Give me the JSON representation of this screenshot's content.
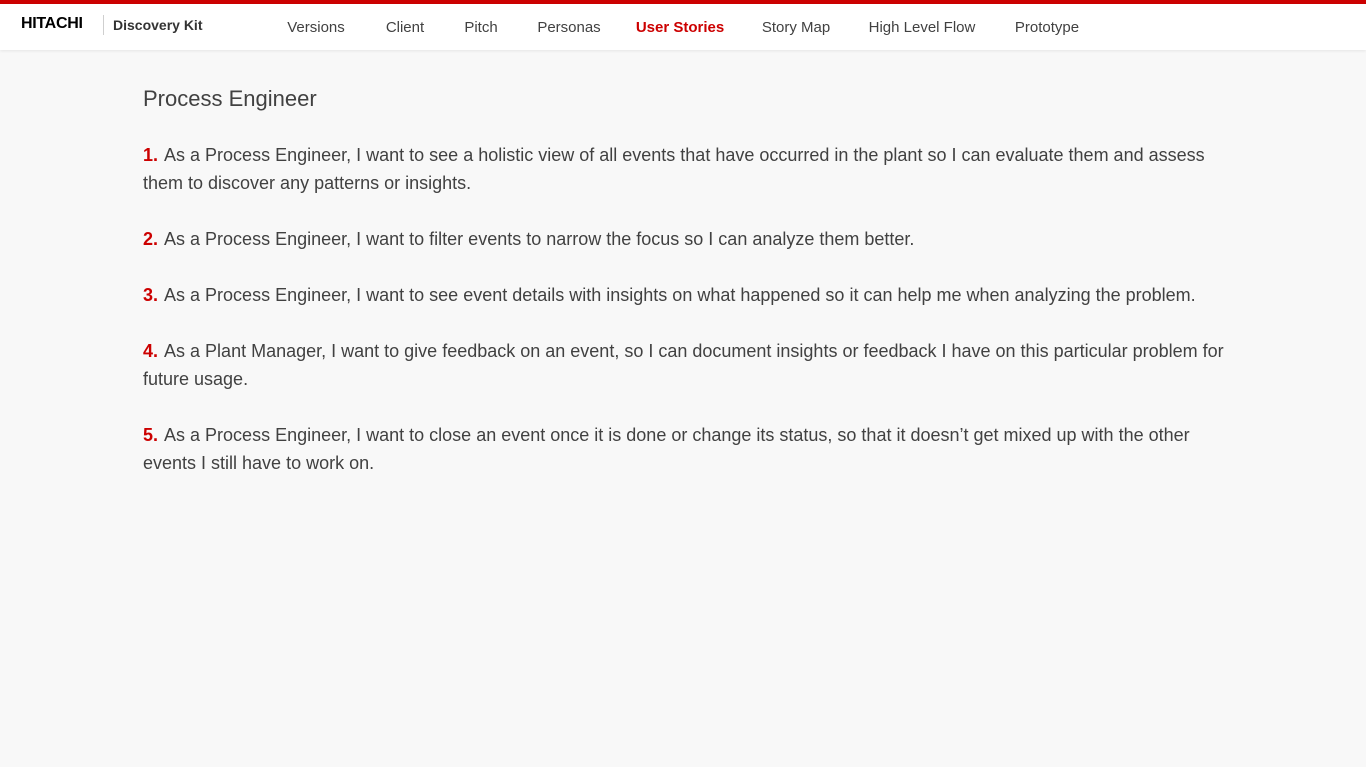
{
  "header": {
    "logo": "HITACHI",
    "app_name": "Discovery Kit",
    "nav": [
      {
        "label": "Versions"
      },
      {
        "label": "Client"
      },
      {
        "label": "Pitch"
      },
      {
        "label": "Personas"
      },
      {
        "label": "User Stories",
        "active": true
      },
      {
        "label": "Story Map"
      },
      {
        "label": "High Level Flow"
      },
      {
        "label": "Prototype"
      }
    ],
    "accent_color": "#cc0000"
  },
  "main": {
    "title": "Process Engineer",
    "stories": [
      {
        "num": "1.",
        "text": "As a Process Engineer, I want to see a holistic view of all events that have occurred in the plant so I can evaluate them and assess them to discover any patterns or insights."
      },
      {
        "num": "2.",
        "text": "As a Process Engineer, I want to filter events to narrow the focus so I can analyze them better."
      },
      {
        "num": "3.",
        "text": "As a Process Engineer, I want to see event details with insights on what happened so it can help me when analyzing the problem."
      },
      {
        "num": "4.",
        "text": "As a Plant Manager, I want to give feedback on an event, so I can document insights or feedback I have on this particular problem for future usage."
      },
      {
        "num": "5.",
        "text": "As a Process Engineer, I want to close an event once it is done or change its status, so that it doesn’t get mixed up with the other events I still have to work on."
      }
    ]
  }
}
